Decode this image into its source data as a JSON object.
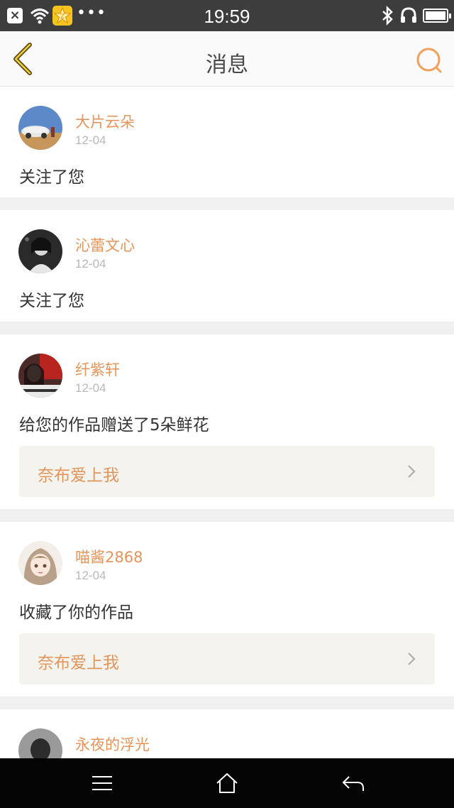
{
  "status_bar": {
    "time": "19:59",
    "app_badge": "Z",
    "more": "•••"
  },
  "header": {
    "title": "消息",
    "accent_color": "#e3955c"
  },
  "messages": [
    {
      "username": "大片云朵",
      "date": "12-04",
      "action": "关注了您"
    },
    {
      "username": "沁蕾文心",
      "date": "12-04",
      "action": "关注了您"
    },
    {
      "username": "纤紫轩",
      "date": "12-04",
      "action": "给您的作品赠送了5朵鲜花",
      "work_title": "奈布爱上我"
    },
    {
      "username": "喵酱2868",
      "date": "12-04",
      "action": "收藏了你的作品",
      "work_title": "奈布爱上我"
    },
    {
      "username": "永夜的浮光"
    }
  ],
  "icons": {
    "back": "chevron-left-icon",
    "search": "search-icon",
    "menu": "menu-icon",
    "home": "home-icon",
    "return": "return-icon"
  }
}
